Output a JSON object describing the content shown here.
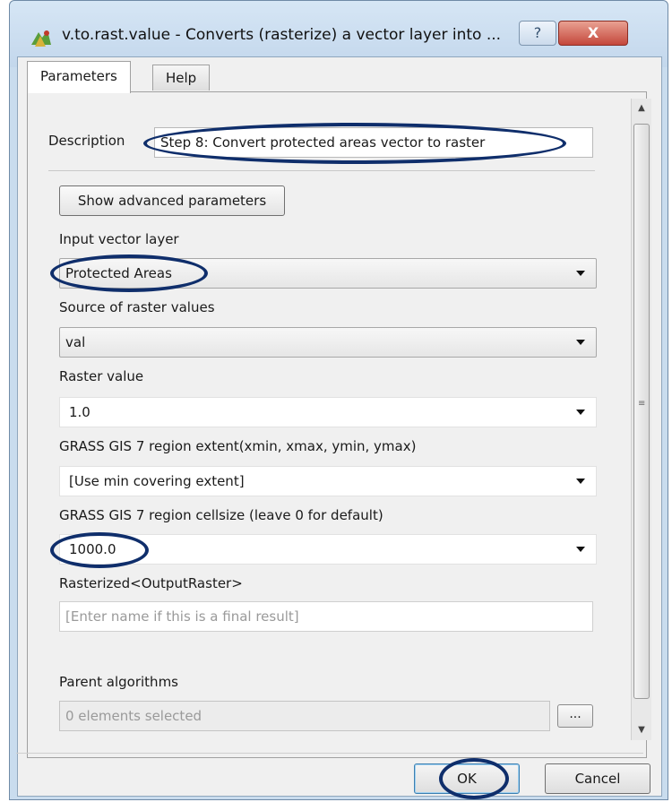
{
  "window": {
    "title": "v.to.rast.value - Converts (rasterize) a vector layer into ...",
    "help_glyph": "?",
    "close_glyph": "X"
  },
  "tabs": [
    {
      "label": "Parameters",
      "active": true
    },
    {
      "label": "Help",
      "active": false
    }
  ],
  "form": {
    "description_label": "Description",
    "description_value": "Step 8: Convert protected areas vector to raster",
    "advanced_button": "Show advanced parameters",
    "input_vector_label": "Input vector layer",
    "input_vector_value": "Protected Areas",
    "source_label": "Source of raster values",
    "source_value": "val",
    "raster_value_label": "Raster value",
    "raster_value": "1.0",
    "region_extent_label": "GRASS GIS 7 region extent(xmin, xmax, ymin, ymax)",
    "region_extent_value": "[Use min covering extent]",
    "cellsize_label": "GRASS GIS 7 region cellsize (leave 0 for default)",
    "cellsize_value": "1000.0",
    "output_label": "Rasterized<OutputRaster>",
    "output_placeholder": "[Enter name if this is a final result]",
    "parent_label": "Parent algorithms",
    "parent_value": "0 elements selected",
    "parent_button": "..."
  },
  "buttons": {
    "ok": "OK",
    "cancel": "Cancel"
  },
  "colors": {
    "annotation_ring": "#0f2e6b",
    "title_bar": "#c9dcee",
    "close_button": "#c4473b"
  },
  "icons": [
    "qgis-app-icon",
    "help-icon",
    "close-icon",
    "dropdown-arrow-icon",
    "scroll-up-icon",
    "scroll-down-icon"
  ]
}
